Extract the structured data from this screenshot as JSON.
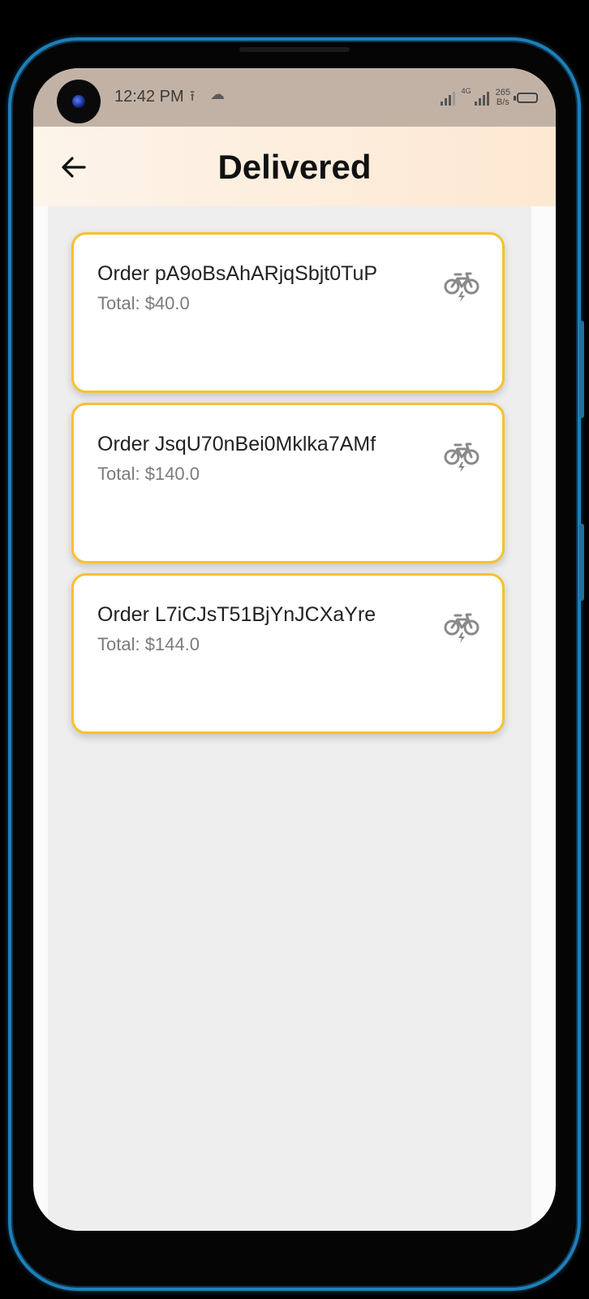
{
  "status_bar": {
    "time": "12:42 PM",
    "network_type": "4G",
    "net_speed_value": "265",
    "net_speed_unit": "B/s"
  },
  "header": {
    "title": "Delivered",
    "back_icon": "arrow-left-icon"
  },
  "orders": [
    {
      "title": "Order pA9oBsAhARjqSbjt0TuP",
      "total": "Total: $40.0",
      "icon": "bicycle-icon"
    },
    {
      "title": "Order JsqU70nBei0Mklka7AMf",
      "total": "Total: $140.0",
      "icon": "bicycle-icon"
    },
    {
      "title": "Order L7iCJsT51BjYnJCXaYre",
      "total": "Total: $144.0",
      "icon": "bicycle-icon"
    }
  ],
  "colors": {
    "card_border": "#f7c12e",
    "header_gradient_start": "#fdf4ea",
    "header_gradient_end": "#fde8d2",
    "content_bg": "#eeeeee"
  }
}
